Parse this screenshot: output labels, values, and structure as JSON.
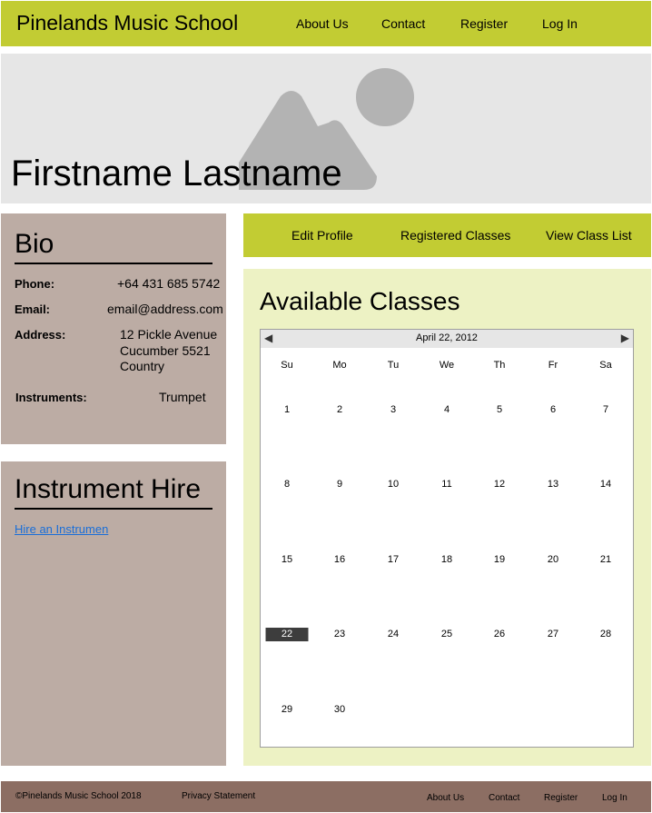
{
  "header": {
    "site_title": "Pinelands Music School",
    "nav": [
      {
        "label": "About Us"
      },
      {
        "label": "Contact"
      },
      {
        "label": "Register"
      },
      {
        "label": "Log In"
      }
    ]
  },
  "banner": {
    "profile_name": "Firstname Lastname",
    "image_icon": "image-placeholder-icon"
  },
  "bio": {
    "heading": "Bio",
    "phone_label": "Phone:",
    "phone_value": "+64 431 685 5742",
    "email_label": "Email:",
    "email_value": "email@address.com",
    "address_label": "Address:",
    "address_line1": "12  Pickle Avenue",
    "address_line2": "Cucumber 5521",
    "address_line3": "Country",
    "instruments_label": "Instruments:",
    "instruments_value": "Trumpet"
  },
  "hire": {
    "heading": "Instrument Hire",
    "link": "Hire an Instrumen"
  },
  "tabs": [
    {
      "label": "Edit Profile"
    },
    {
      "label": "Registered Classes"
    },
    {
      "label": "View Class List"
    }
  ],
  "classes": {
    "title": "Available Classes",
    "calendar": {
      "month_label": "April 22, 2012",
      "prev_icon": "left-triangle-icon",
      "next_icon": "right-triangle-icon",
      "weekdays": [
        "Su",
        "Mo",
        "Tu",
        "We",
        "Th",
        "Fr",
        "Sa"
      ],
      "weeks": [
        [
          "1",
          "2",
          "3",
          "4",
          "5",
          "6",
          "7"
        ],
        [
          "8",
          "9",
          "10",
          "11",
          "12",
          "13",
          "14"
        ],
        [
          "15",
          "16",
          "17",
          "18",
          "19",
          "20",
          "21"
        ],
        [
          "22",
          "23",
          "24",
          "25",
          "26",
          "27",
          "28"
        ],
        [
          "29",
          "30",
          "",
          "",
          "",
          "",
          ""
        ]
      ],
      "selected_day": "22"
    }
  },
  "footer": {
    "copyright": "©Pinelands Music School 2018",
    "privacy": "Privacy Statement",
    "nav": [
      {
        "label": "About Us"
      },
      {
        "label": "Contact"
      },
      {
        "label": "Register"
      },
      {
        "label": "Log In"
      }
    ]
  },
  "colors": {
    "header_green": "#c2cc33",
    "panel_taupe": "#bcaca4",
    "classes_bg": "#edf2c4",
    "footer_brown": "#8c6e63",
    "link_blue": "#1a6ed8"
  }
}
